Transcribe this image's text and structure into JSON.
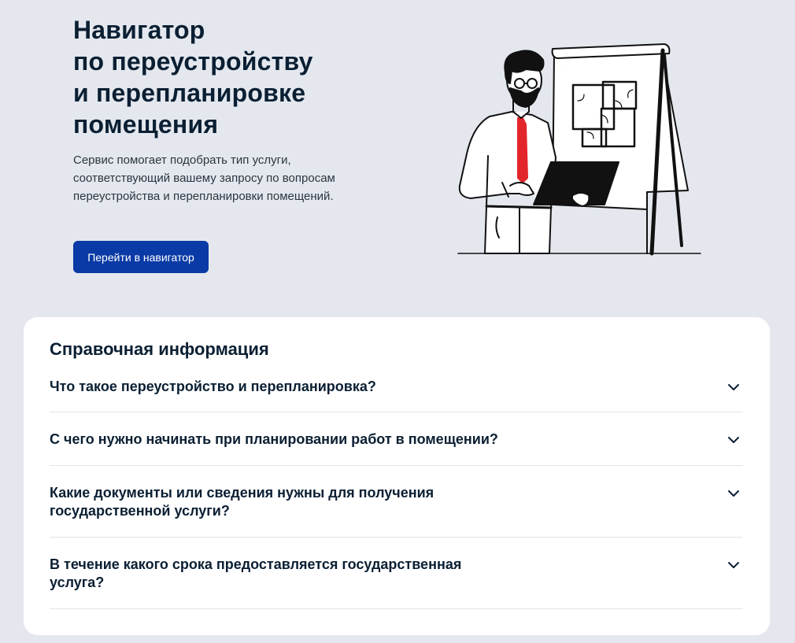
{
  "hero": {
    "title_lines": [
      "Навигатор",
      "по переустройству",
      "и перепланировке",
      "помещения"
    ],
    "description": "Сервис помогает подобрать тип услуги, соответствующий вашему запросу по вопросам переустройства и перепланировки помещений.",
    "cta_label": "Перейти в навигатор",
    "illustration_icon": "man-with-laptop-and-floorplan-illustration"
  },
  "reference": {
    "title": "Справочная информация",
    "items": [
      {
        "question": "Что такое переустройство и перепланировка?"
      },
      {
        "question": "С чего нужно начинать при планировании работ в помещении?"
      },
      {
        "question": "Какие документы или сведения нужны для получения государственной услуги?"
      },
      {
        "question": "В течение какого срока предоставляется государственная услуга?"
      }
    ],
    "expand_icon": "chevron-down-icon"
  },
  "colors": {
    "background": "#e4e8ee",
    "primary_button": "#0a3aa5",
    "text": "#0b1f33",
    "tie": "#e3262b"
  }
}
